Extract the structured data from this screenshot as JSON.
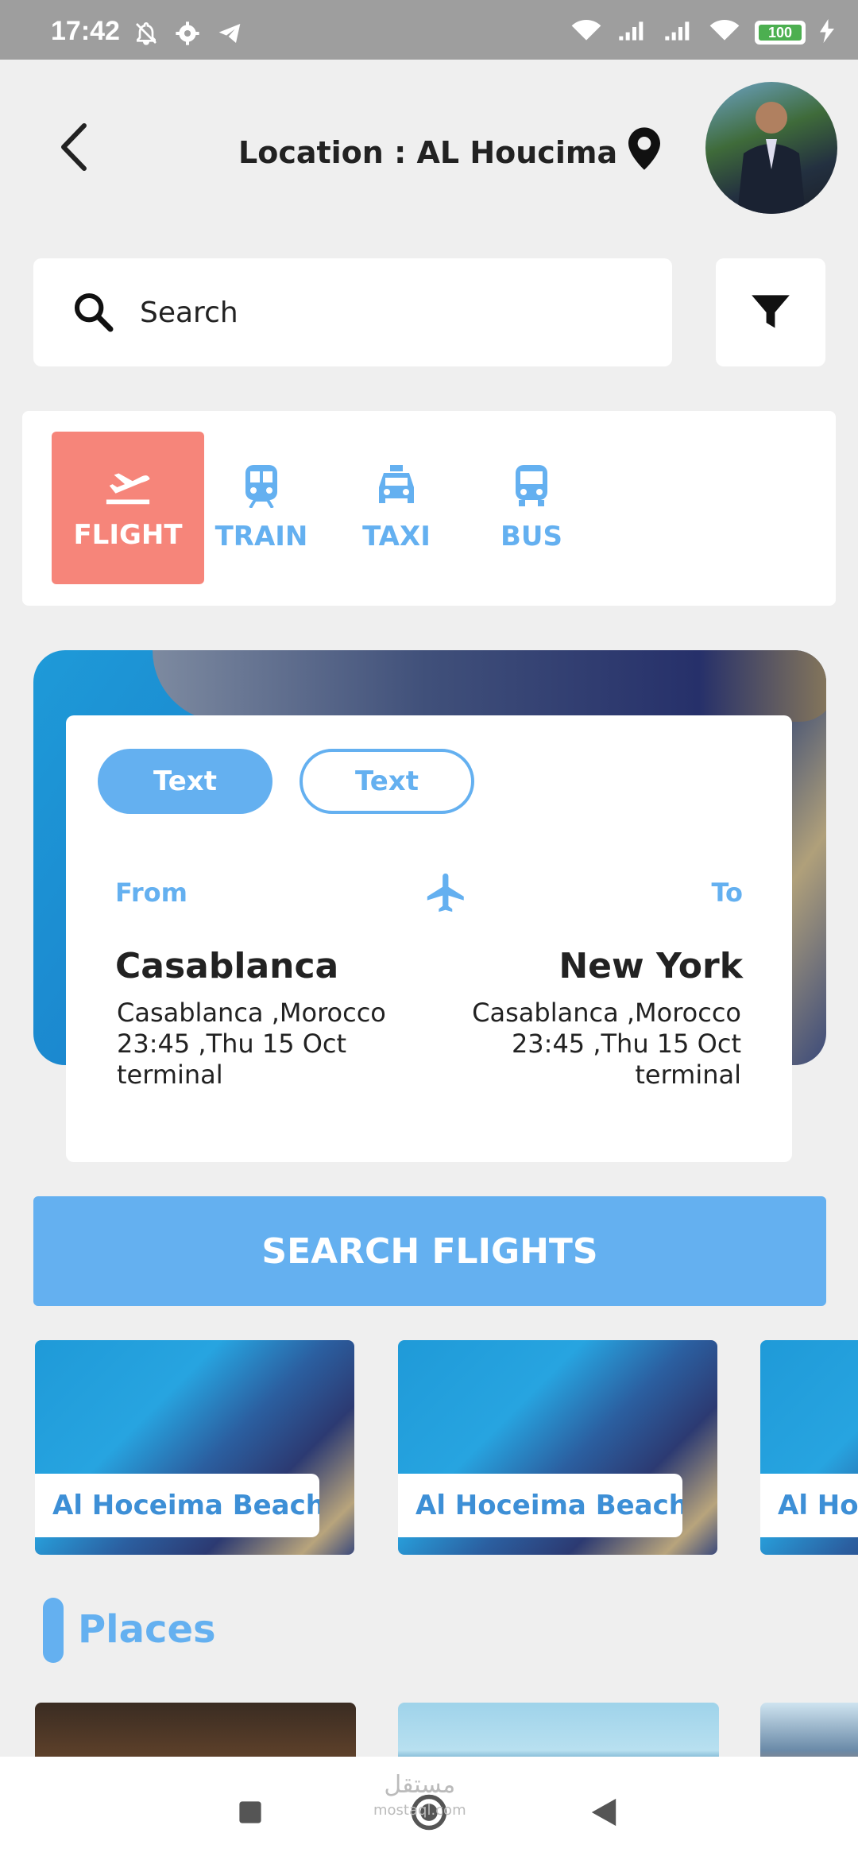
{
  "status_bar": {
    "time": "17:42",
    "battery": "100",
    "icons_left": [
      "bell-off-icon",
      "gear-icon",
      "telegram-icon"
    ],
    "icons_right": [
      "wifi-icon",
      "signal-icon",
      "signal-icon",
      "wifi-icon",
      "battery-icon",
      "charging-icon"
    ]
  },
  "header": {
    "location_text": "Location : AL Houcima",
    "location_icon": "map-pin-icon"
  },
  "search": {
    "placeholder": "Search"
  },
  "tabs": [
    {
      "label": "FLIGHT",
      "icon": "plane-departure-icon",
      "active": true
    },
    {
      "label": "TRAIN",
      "icon": "train-icon",
      "active": false
    },
    {
      "label": "TAXI",
      "icon": "taxi-icon",
      "active": false
    },
    {
      "label": "BUS",
      "icon": "bus-icon",
      "active": false
    }
  ],
  "trip": {
    "toggle_filled": "Text",
    "toggle_outline": "Text",
    "from_label": "From",
    "to_label": "To",
    "from": {
      "city": "Casablanca",
      "line1": "Casablanca ,Morocco",
      "line2": "23:45 ,Thu 15 Oct",
      "line3": "terminal"
    },
    "to": {
      "city": "New York",
      "line1": "Casablanca ,Morocco",
      "line2": "23:45 ,Thu 15 Oct",
      "line3": "terminal"
    }
  },
  "search_button": "SEARCH FLIGHTS",
  "beaches": [
    {
      "label": "Al Hoceima Beach"
    },
    {
      "label": "Al Hoceima Beach"
    },
    {
      "label": "Al Hoceima Beach"
    }
  ],
  "places_title": "Places",
  "watermark": {
    "main": "مستقل",
    "sub": "mostaql.com"
  },
  "colors": {
    "accent": "#64b0f0",
    "active_tab": "#f6857a",
    "status_bar": "#9e9e9e"
  }
}
